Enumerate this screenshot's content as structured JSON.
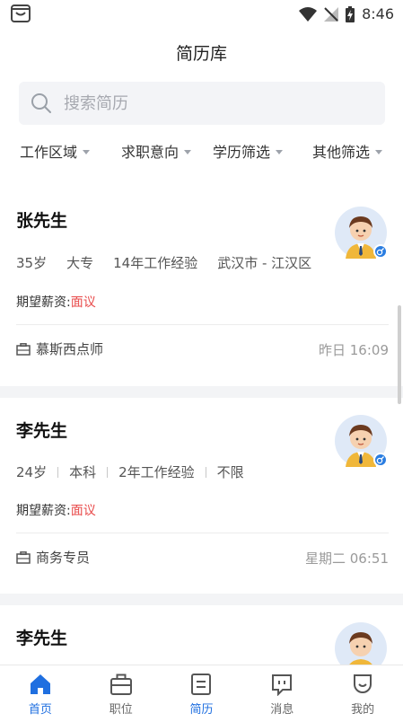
{
  "status": {
    "time": "8:46"
  },
  "header": {
    "title": "简历库"
  },
  "search": {
    "placeholder": "搜索简历"
  },
  "filters": [
    "工作区域",
    "求职意向",
    "学历筛选",
    "其他筛选"
  ],
  "cards": [
    {
      "name": "张先生",
      "info": [
        "35岁",
        "大专",
        "14年工作经验",
        "武汉市 - 江汉区"
      ],
      "salary_label": "期望薪资:",
      "salary_value": "面议",
      "job": "慕斯西点师",
      "time": "昨日 16:09"
    },
    {
      "name": "李先生",
      "info": [
        "24岁",
        "本科",
        "2年工作经验",
        "不限"
      ],
      "salary_label": "期望薪资:",
      "salary_value": "面议",
      "job": "商务专员",
      "time": "星期二 06:51"
    },
    {
      "name": "李先生"
    }
  ],
  "tabs": [
    {
      "label": "首页",
      "icon": "home-icon",
      "active": true
    },
    {
      "label": "职位",
      "icon": "briefcase-icon",
      "active": false
    },
    {
      "label": "简历",
      "icon": "resume-icon",
      "active": false
    },
    {
      "label": "消息",
      "icon": "message-icon",
      "active": false
    },
    {
      "label": "我的",
      "icon": "profile-icon",
      "active": false
    }
  ],
  "colors": {
    "accent": "#1f6fe0",
    "salary": "#e84a4a"
  }
}
